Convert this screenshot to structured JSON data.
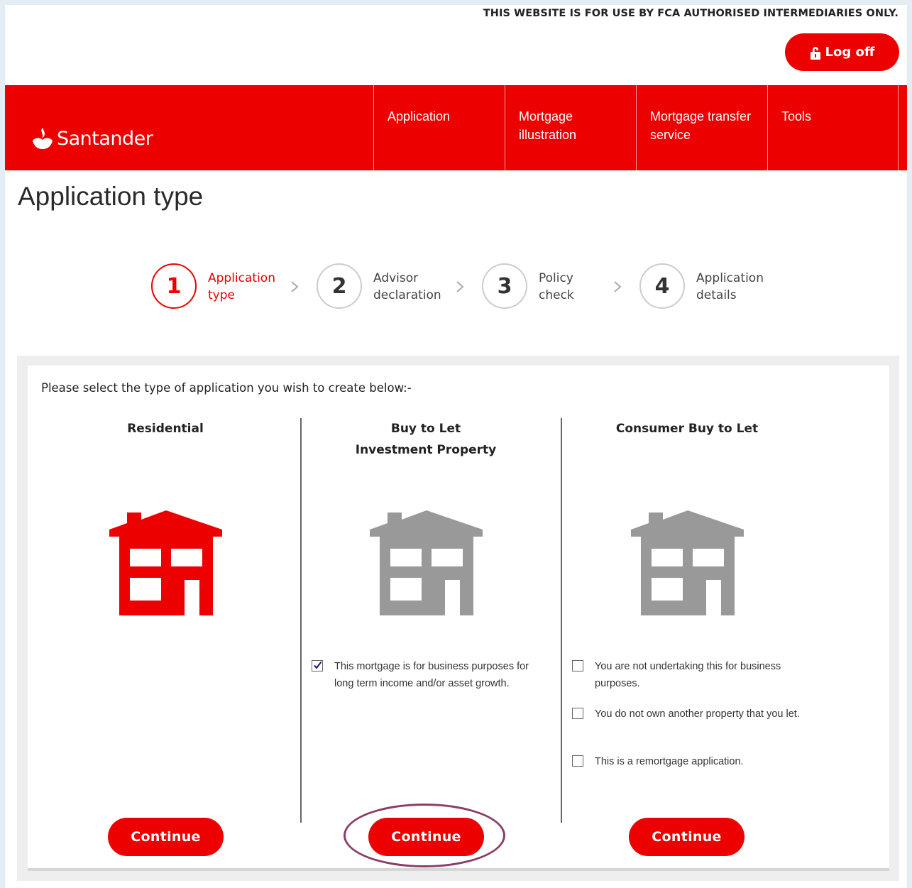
{
  "header": {
    "disclaimer": "THIS WEBSITE IS FOR USE BY FCA AUTHORISED INTERMEDIARIES ONLY.",
    "logoff_label": "Log off",
    "logoff_icon": "lock-icon"
  },
  "brand": {
    "name": "Santander",
    "logo_icon": "santander-flame-logo"
  },
  "nav": {
    "items": [
      {
        "label": "Application"
      },
      {
        "label": "Mortgage illustration"
      },
      {
        "label": "Mortgage transfer service"
      },
      {
        "label": "Tools"
      }
    ]
  },
  "page": {
    "title": "Application type"
  },
  "stepper": {
    "steps": [
      {
        "number": "1",
        "label_line1": "Application",
        "label_line2": "type",
        "active": true
      },
      {
        "number": "2",
        "label_line1": "Advisor",
        "label_line2": "declaration",
        "active": false
      },
      {
        "number": "3",
        "label_line1": "Policy",
        "label_line2": "check",
        "active": false
      },
      {
        "number": "4",
        "label_line1": "Application",
        "label_line2": "details",
        "active": false
      }
    ]
  },
  "panel": {
    "intro": "Please select the type of application you wish to create below:-",
    "options": [
      {
        "title_line1": "Residential",
        "title_line2": "",
        "icon": "house-icon",
        "icon_color": "#ec0000",
        "continue_label": "Continue",
        "checks": []
      },
      {
        "title_line1": "Buy to Let",
        "title_line2": "Investment Property",
        "icon": "house-icon",
        "icon_color": "#999999",
        "continue_label": "Continue",
        "checks": [
          {
            "text": "This mortgage is for business purposes for long term income and/or asset growth.",
            "checked": true
          }
        ]
      },
      {
        "title_line1": "Consumer Buy to Let",
        "title_line2": "",
        "icon": "house-icon",
        "icon_color": "#999999",
        "continue_label": "Continue",
        "checks": [
          {
            "text": "You are not undertaking this for business purposes.",
            "checked": false
          },
          {
            "text": "You do not own another property that you let.",
            "checked": false
          },
          {
            "text": "This is a remortgage application.",
            "checked": false
          }
        ]
      }
    ]
  },
  "colors": {
    "brand_red": "#ec0000",
    "highlight_ring": "#8b3d65",
    "inactive_icon": "#999999"
  }
}
